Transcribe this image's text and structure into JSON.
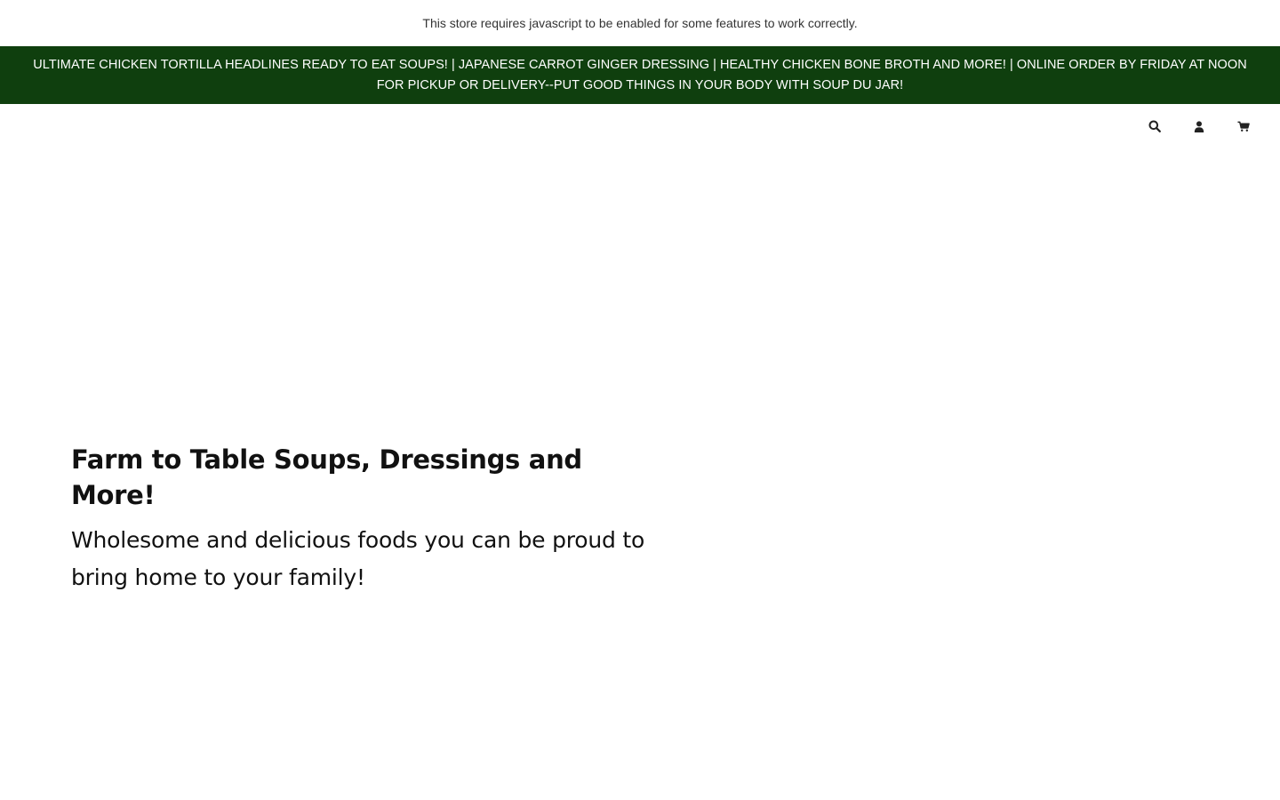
{
  "notice": {
    "text": "This store requires javascript to be enabled for some features to work correctly."
  },
  "announcement": {
    "text": "ULTIMATE CHICKEN TORTILLA HEADLINES READY TO EAT SOUPS! | JAPANESE CARROT GINGER DRESSING | HEALTHY CHICKEN BONE BROTH AND MORE! | ONLINE ORDER BY FRIDAY AT NOON FOR PICKUP OR DELIVERY--PUT GOOD THINGS IN YOUR BODY WITH SOUP DU JAR!",
    "background_color": "#0f3f0e",
    "text_color": "#ffffff"
  },
  "header": {
    "icons": [
      "search-icon",
      "account-icon",
      "cart-icon"
    ]
  },
  "hero": {
    "title": "Farm to Table Soups, Dressings and More!",
    "subtitle": "Wholesome and delicious foods you can be proud to bring home to your family!"
  }
}
